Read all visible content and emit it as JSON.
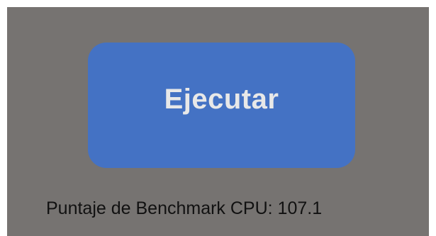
{
  "run_button": {
    "label": "Ejecutar"
  },
  "result": {
    "text": "Puntaje de Benchmark CPU: 107.1"
  },
  "colors": {
    "background": "#767371",
    "button": "#4472c4",
    "button_text": "#e8e8e8",
    "result_text": "#111111"
  }
}
